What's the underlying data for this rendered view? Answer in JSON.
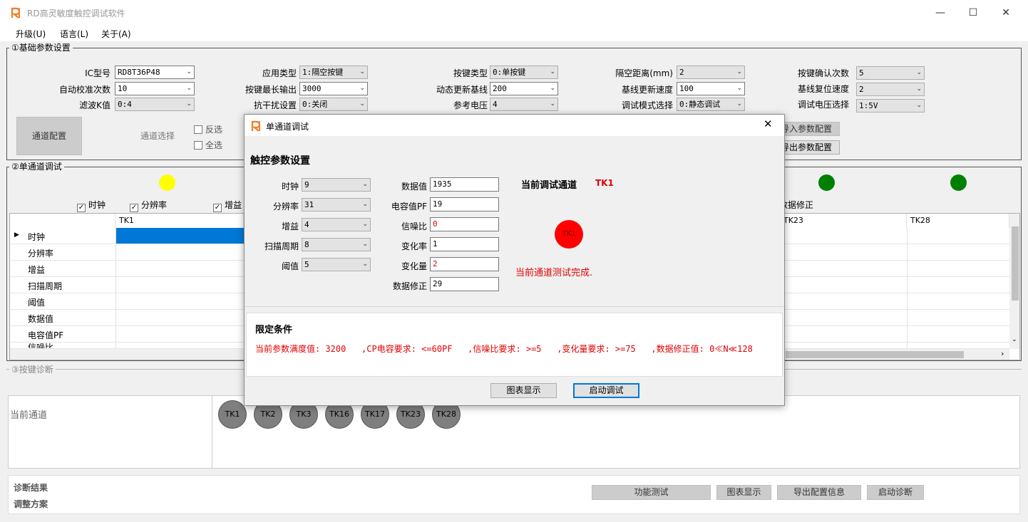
{
  "window": {
    "title": "RD高灵敏度触控调试软件",
    "minimize": "—",
    "maximize": "☐",
    "close": "✕"
  },
  "menu": [
    "升级(U)",
    "语言(L)",
    "关于(A)"
  ],
  "basic": {
    "title": "①基础参数设置",
    "col1": [
      {
        "label": "IC型号",
        "value": "RD8T36P48"
      },
      {
        "label": "自动校准次数",
        "value": "10"
      },
      {
        "label": "滤波K值",
        "value": "0:4"
      }
    ],
    "col2": [
      {
        "label": "应用类型",
        "value": "1:隔空按键"
      },
      {
        "label": "按键最长输出",
        "value": "3000"
      },
      {
        "label": "抗干扰设置",
        "value": "0:关闭"
      }
    ],
    "col3": [
      {
        "label": "按键类型",
        "value": "0:单按键"
      },
      {
        "label": "动态更新基线",
        "value": "200"
      },
      {
        "label": "参考电压",
        "value": "4"
      }
    ],
    "col4": [
      {
        "label": "隔空距离(mm)",
        "value": "2"
      },
      {
        "label": "基线更新速度",
        "value": "100"
      },
      {
        "label": "调试模式选择",
        "value": "0:静态调试"
      }
    ],
    "col5": [
      {
        "label": "按键确认次数",
        "value": "5"
      },
      {
        "label": "基线复位速度",
        "value": "2"
      },
      {
        "label": "调试电压选择",
        "value": "1:5V"
      }
    ],
    "channel_config_btn": "通道配置",
    "channel_select": "通道选择",
    "invert": "反选",
    "select_all": "全选",
    "import_btn": "导入参数配置",
    "export_btn": "导出参数配置"
  },
  "single": {
    "title": "②单通道调试",
    "checks": [
      "时钟",
      "分辨率",
      "增益"
    ],
    "check_right": "数据修正",
    "columns": [
      "TK1",
      "TK23",
      "TK28"
    ],
    "rows": [
      "时钟",
      "分辨率",
      "增益",
      "扫描周期",
      "阈值",
      "数据值",
      "电容值PF",
      "信噪比"
    ]
  },
  "diag": {
    "title": "③按键诊断",
    "current_channel": "当前通道",
    "channels": [
      "TK1",
      "TK2",
      "TK3",
      "TK16",
      "TK17",
      "TK23",
      "TK28"
    ],
    "result": "诊断结果",
    "plan": "调整方案",
    "buttons": [
      "功能测试",
      "图表显示",
      "导出配置信息",
      "启动诊断"
    ]
  },
  "dialog": {
    "title": "单通道调试",
    "section": "触控参数设置",
    "left": [
      {
        "label": "时钟",
        "value": "9"
      },
      {
        "label": "分辨率",
        "value": "31"
      },
      {
        "label": "增益",
        "value": "4"
      },
      {
        "label": "扫描周期",
        "value": "8"
      },
      {
        "label": "阈值",
        "value": "5"
      }
    ],
    "right": [
      {
        "label": "数据值",
        "value": "1935"
      },
      {
        "label": "电容值PF",
        "value": "19"
      },
      {
        "label": "信噪比",
        "value": "0"
      },
      {
        "label": "变化率",
        "value": "1"
      },
      {
        "label": "变化量",
        "value": "2"
      },
      {
        "label": "数据修正",
        "value": "29"
      }
    ],
    "current_label": "当前调试通道",
    "current_channel": "TK1",
    "indicator": "TK1",
    "status": "当前通道测试完成.",
    "limit_title": "限定条件",
    "limit_text": "当前参数满度值: 3200   ,CP电容要求: <=60PF   ,信噪比要求: >=5   ,变化量要求: >=75   ,数据修正值: 0≪N≪128",
    "chart_btn": "图表显示",
    "start_btn": "启动调试"
  },
  "colors": {
    "yellow": "#ffff00",
    "green": "#008000",
    "red": "#ff0000",
    "select": "#0078d7"
  }
}
